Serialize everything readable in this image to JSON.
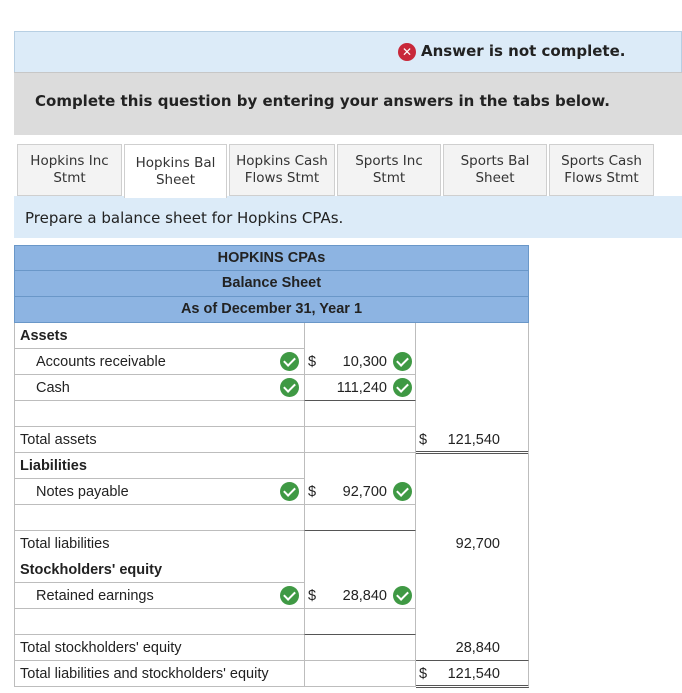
{
  "banner": {
    "message": "Answer is not complete.",
    "icon": "x-icon"
  },
  "instruction": "Complete this question by entering your answers in the tabs below.",
  "tabs": [
    {
      "label": "Hopkins Inc Stmt",
      "line1": "Hopkins Inc",
      "line2": "Stmt",
      "active": false
    },
    {
      "label": "Hopkins Bal Sheet",
      "line1": "Hopkins Bal",
      "line2": "Sheet",
      "active": true
    },
    {
      "label": "Hopkins Cash Flows Stmt",
      "line1": "Hopkins Cash",
      "line2": "Flows Stmt",
      "active": false
    },
    {
      "label": "Sports Inc Stmt",
      "line1": "Sports Inc",
      "line2": "Stmt",
      "active": false
    },
    {
      "label": "Sports Bal Sheet",
      "line1": "Sports Bal",
      "line2": "Sheet",
      "active": false
    },
    {
      "label": "Sports Cash Flows Stmt",
      "line1": "Sports Cash",
      "line2": "Flows Stmt",
      "active": false
    }
  ],
  "prompt": "Prepare a balance sheet for Hopkins CPAs.",
  "sheet": {
    "company": "HOPKINS CPAs",
    "title": "Balance Sheet",
    "date": "As of December 31, Year 1",
    "assets_heading": "Assets",
    "accounts_receivable": {
      "label": "Accounts receivable",
      "currency": "$",
      "value": "10,300"
    },
    "cash": {
      "label": "Cash",
      "value": "111,240"
    },
    "total_assets": {
      "label": "Total assets",
      "currency": "$",
      "value": "121,540"
    },
    "liabilities_heading": "Liabilities",
    "notes_payable": {
      "label": "Notes payable",
      "currency": "$",
      "value": "92,700"
    },
    "total_liabilities": {
      "label": "Total liabilities",
      "value": "92,700"
    },
    "equity_heading": "Stockholders' equity",
    "retained_earnings": {
      "label": "Retained earnings",
      "currency": "$",
      "value": "28,840"
    },
    "total_equity": {
      "label": "Total stockholders' equity",
      "value": "28,840"
    },
    "total_liab_equity": {
      "label": "Total liabilities and stockholders' equity",
      "currency": "$",
      "value": "121,540"
    }
  },
  "colors": {
    "header_blue": "#8db4e2",
    "banner_blue": "#dcebf8",
    "check_green": "#3f9944",
    "error_red": "#c8283a"
  }
}
